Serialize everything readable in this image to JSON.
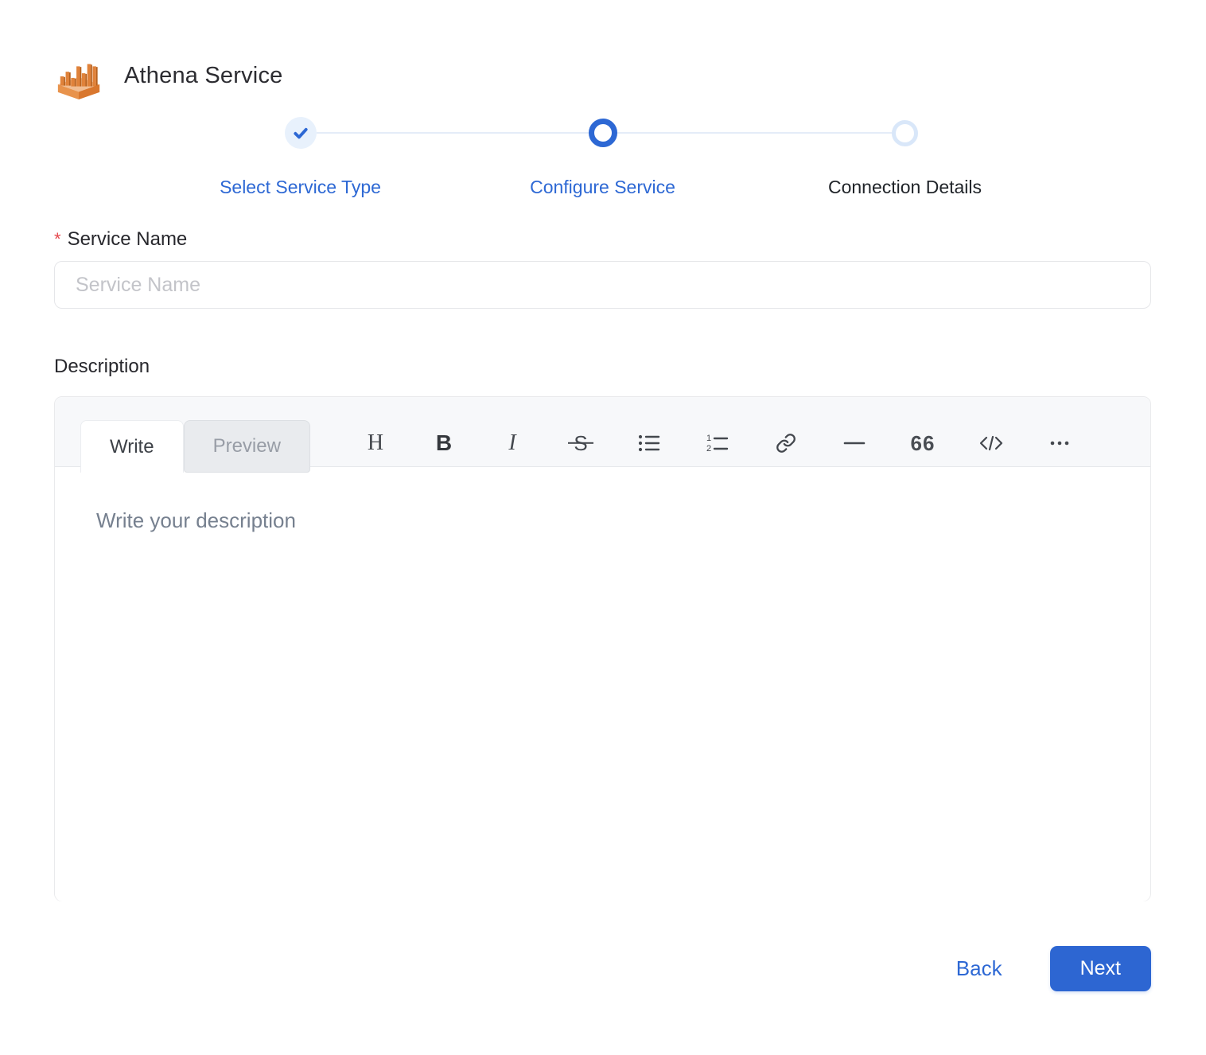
{
  "header": {
    "title": "Athena Service"
  },
  "stepper": {
    "steps": [
      {
        "label": "Select Service Type",
        "state": "completed"
      },
      {
        "label": "Configure Service",
        "state": "active"
      },
      {
        "label": "Connection Details",
        "state": "upcoming"
      }
    ]
  },
  "form": {
    "service_name": {
      "label": "Service Name",
      "required_marker": "*",
      "placeholder": "Service Name",
      "value": ""
    },
    "description": {
      "label": "Description",
      "placeholder": "Write your description",
      "value": ""
    }
  },
  "editor": {
    "tabs": [
      {
        "label": "Write"
      },
      {
        "label": "Preview"
      }
    ],
    "active_tab": "Write",
    "toolbar_glyphs": {
      "heading": "H",
      "bold": "B",
      "italic": "I",
      "strikethrough": "S",
      "quote": "66",
      "code": "</>"
    },
    "toolbar_items": [
      "heading",
      "bold",
      "italic",
      "strikethrough",
      "bulleted-list",
      "numbered-list",
      "link",
      "horizontal-rule",
      "quote",
      "code",
      "more-options"
    ]
  },
  "footer": {
    "back_label": "Back",
    "next_label": "Next"
  },
  "colors": {
    "accent_blue": "#2d68d4",
    "next_button_blue": "#2d66d2",
    "step_done_bg": "#e8f1fc",
    "step_pending_ring": "#d9e7f9",
    "connector": "#e4ecf8",
    "required_red": "#e5484d",
    "logo_orange": "#e0823a"
  }
}
